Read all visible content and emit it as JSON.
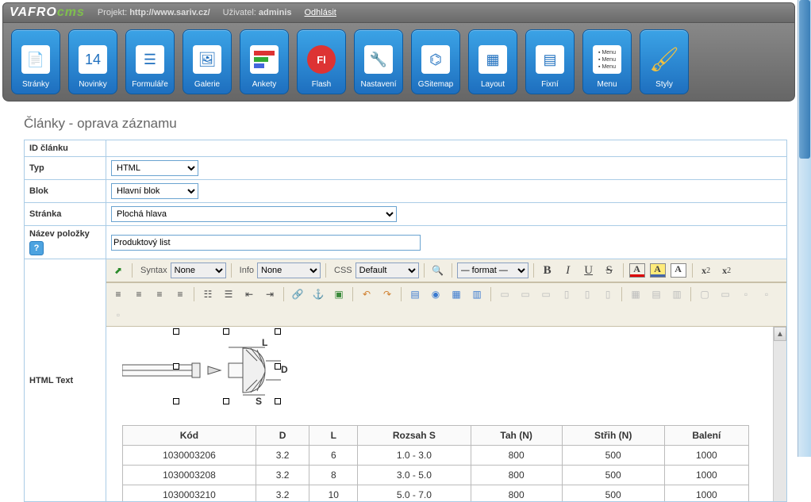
{
  "header": {
    "logo_text": "VAFRO",
    "logo_suffix": "cms",
    "project_label": "Projekt:",
    "project_url": "http://www.sariv.cz/",
    "user_label": "Uživatel:",
    "user_name": "adminis",
    "logout": "Odhlásit"
  },
  "toolbar": [
    {
      "label": "Stránky",
      "icon": "page-icon"
    },
    {
      "label": "Novinky",
      "icon": "calendar-icon",
      "badge": "14"
    },
    {
      "label": "Formuláře",
      "icon": "form-icon"
    },
    {
      "label": "Galerie",
      "icon": "gallery-icon"
    },
    {
      "label": "Ankety",
      "icon": "poll-icon"
    },
    {
      "label": "Flash",
      "icon": "flash-icon"
    },
    {
      "label": "Nastavení",
      "icon": "settings-icon"
    },
    {
      "label": "GSitemap",
      "icon": "sitemap-icon"
    },
    {
      "label": "Layout",
      "icon": "layout-icon"
    },
    {
      "label": "Fixní",
      "icon": "fixed-icon"
    },
    {
      "label": "Menu",
      "icon": "menu-icon"
    },
    {
      "label": "Styly",
      "icon": "styles-icon"
    }
  ],
  "page": {
    "title": "Články - oprava záznamu"
  },
  "form": {
    "id_label": "ID článku",
    "type_label": "Typ",
    "type_value": "HTML",
    "block_label": "Blok",
    "block_value": "Hlavní blok",
    "page_label": "Stránka",
    "page_value": "Plochá hlava",
    "name_label": "Název položky",
    "name_value": "Produktový list",
    "html_label": "HTML Text"
  },
  "editor": {
    "syntax_label": "Syntax",
    "syntax_value": "None",
    "info_label": "Info",
    "info_value": "None",
    "css_label": "CSS",
    "css_value": "Default",
    "format_value": "— format —"
  },
  "rivet": {
    "labels": {
      "L": "L",
      "D": "D",
      "S": "S"
    }
  },
  "table": {
    "headers": [
      "Kód",
      "D",
      "L",
      "Rozsah S",
      "Tah (N)",
      "Střih (N)",
      "Balení"
    ],
    "rows": [
      [
        "1030003206",
        "3.2",
        "6",
        "1.0 - 3.0",
        "800",
        "500",
        "1000"
      ],
      [
        "1030003208",
        "3.2",
        "8",
        "3.0 - 5.0",
        "800",
        "500",
        "1000"
      ],
      [
        "1030003210",
        "3.2",
        "10",
        "5.0 - 7.0",
        "800",
        "500",
        "1000"
      ]
    ]
  }
}
